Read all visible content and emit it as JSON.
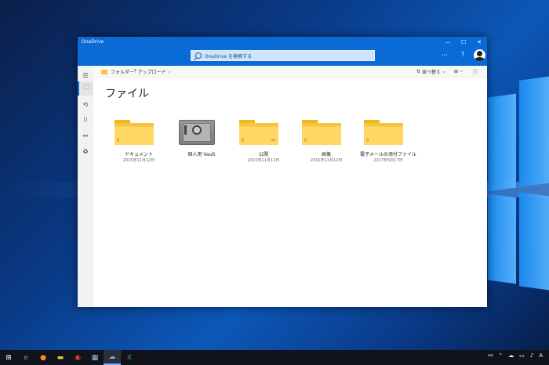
{
  "window": {
    "title": "OneDrive"
  },
  "header": {
    "search_placeholder": "OneDrive を検索する",
    "more": "···",
    "help": "?"
  },
  "sidebar": {
    "items": [
      {
        "icon": "hamburger-icon",
        "glyph": "☰"
      },
      {
        "icon": "folder-icon",
        "glyph": "🗀"
      },
      {
        "icon": "recent-icon",
        "glyph": "⟲"
      },
      {
        "icon": "camera-icon",
        "glyph": "⌷"
      },
      {
        "icon": "shared-icon",
        "glyph": "⚯"
      },
      {
        "icon": "recycle-bin-icon",
        "glyph": "♻"
      }
    ]
  },
  "commandbar": {
    "folder": "フォルダー",
    "upload": "アップロード",
    "upload_chevron": "⌵",
    "sort": "並べ替え",
    "sort_chevron": "⌵",
    "view_chevron": "⌵",
    "info": "ⓘ"
  },
  "page": {
    "title": "ファイル"
  },
  "items": [
    {
      "name": "ドキュメント",
      "date": "2015年11月12日",
      "count": "0"
    },
    {
      "name": "個人用 Vault",
      "date": ""
    },
    {
      "name": "公開",
      "date": "2015年11月12日",
      "count": "0"
    },
    {
      "name": "画像",
      "date": "2015年11月12日",
      "count": "0"
    },
    {
      "name": "電子メールの添付ファイル",
      "date": "2017年5月17日",
      "count": "0"
    }
  ],
  "taskbar": {
    "items": [
      {
        "icon": "start-icon"
      },
      {
        "icon": "edge-icon"
      },
      {
        "icon": "firefox-icon"
      },
      {
        "icon": "explorer-icon"
      },
      {
        "icon": "chrome-icon"
      },
      {
        "icon": "app-icon"
      },
      {
        "icon": "onedrive-icon"
      },
      {
        "icon": "excel-icon"
      }
    ],
    "tray": [
      "A"
    ]
  }
}
